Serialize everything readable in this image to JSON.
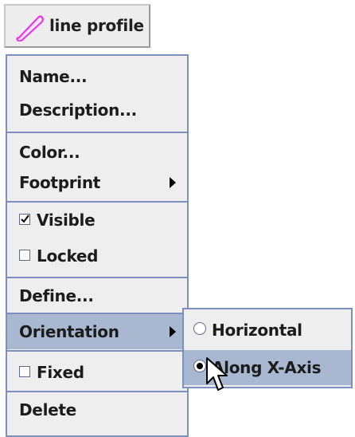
{
  "toolbar": {
    "tool_label": "line profile",
    "tool_icon": "line-profile-icon",
    "icon_color": "#f030f0"
  },
  "context_menu": {
    "name": "Name...",
    "description": "Description...",
    "color": "Color...",
    "footprint": "Footprint",
    "visible": {
      "label": "Visible",
      "checked": true
    },
    "locked": {
      "label": "Locked",
      "checked": false
    },
    "define": "Define...",
    "orientation": "Orientation",
    "fixed": {
      "label": "Fixed",
      "checked": false
    },
    "delete": "Delete"
  },
  "orientation_submenu": {
    "horizontal": {
      "label": "Horizontal",
      "selected": false
    },
    "along_x_axis": {
      "label": "Along X-Axis",
      "selected": true
    }
  },
  "colors": {
    "menu_bg": "#eeeeee",
    "menu_border": "#7d8fbf",
    "highlight": "#a8b8d0"
  }
}
